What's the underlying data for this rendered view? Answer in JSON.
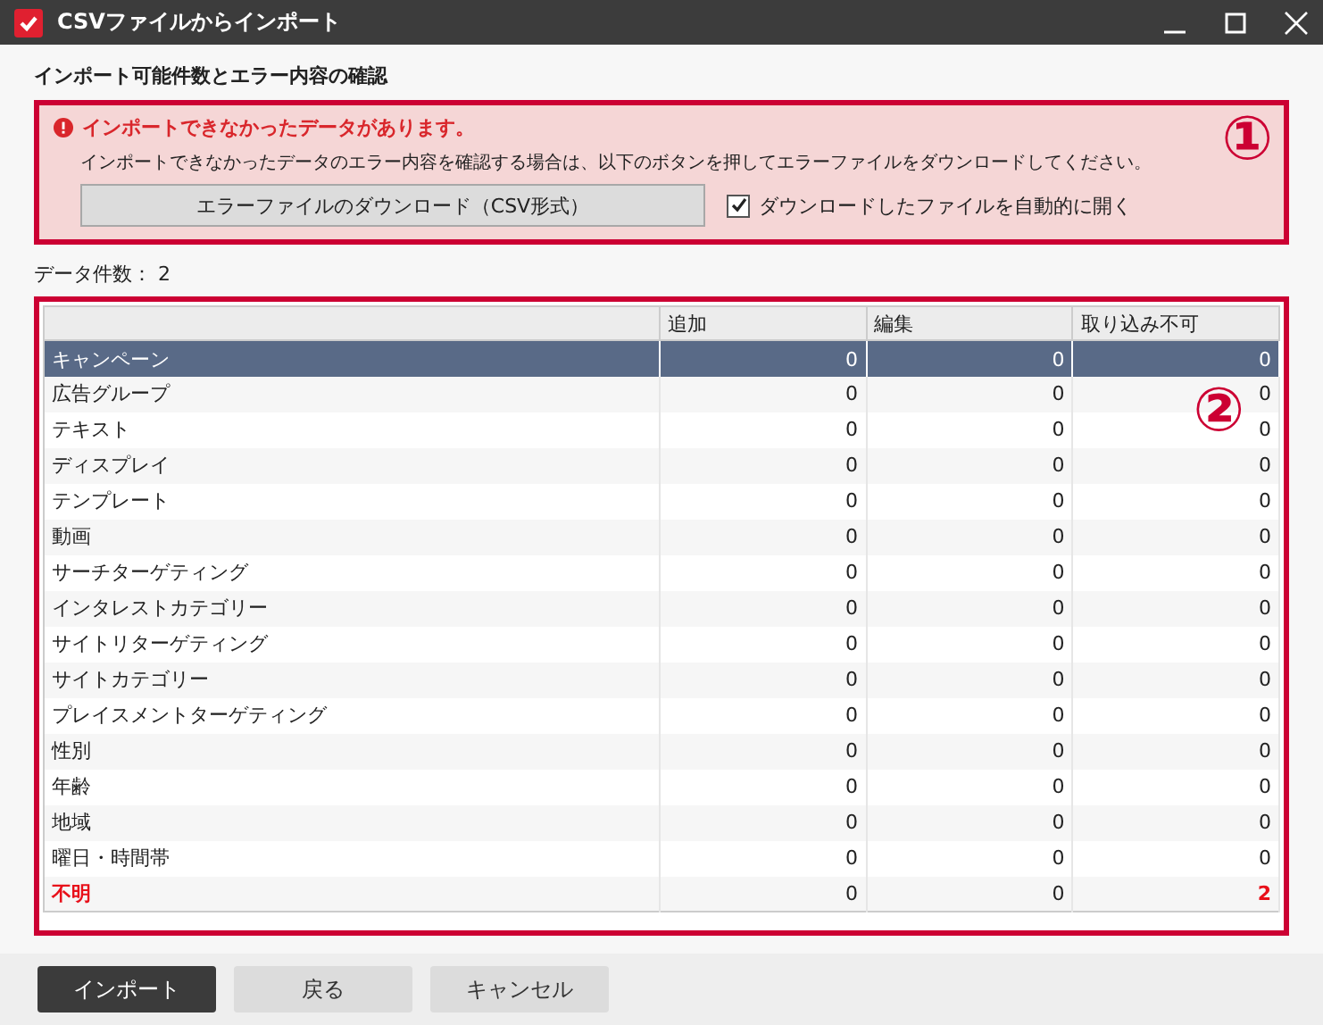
{
  "window": {
    "title": "CSVファイルからインポート"
  },
  "section_title": "インポート可能件数とエラー内容の確認",
  "error_box": {
    "heading": "インポートできなかったデータがあります。",
    "message": "インポートできなかったデータのエラー内容を確認する場合は、以下のボタンを押してエラーファイルをダウンロードしてください。",
    "download_button": "エラーファイルのダウンロード（CSV形式）",
    "auto_open": {
      "label": "ダウンロードしたファイルを自動的に開く",
      "checked": true
    },
    "callout": "①"
  },
  "data_count": {
    "label": "データ件数：",
    "value": "2"
  },
  "table": {
    "callout": "②",
    "columns": [
      "",
      "追加",
      "編集",
      "取り込み不可"
    ],
    "rows": [
      {
        "name": "キャンペーン",
        "values": [
          "0",
          "0",
          "0"
        ],
        "selected": true,
        "error": false
      },
      {
        "name": "広告グループ",
        "values": [
          "0",
          "0",
          "0"
        ],
        "selected": false,
        "error": false
      },
      {
        "name": "テキスト",
        "values": [
          "0",
          "0",
          "0"
        ],
        "selected": false,
        "error": false
      },
      {
        "name": "ディスプレイ",
        "values": [
          "0",
          "0",
          "0"
        ],
        "selected": false,
        "error": false
      },
      {
        "name": "テンプレート",
        "values": [
          "0",
          "0",
          "0"
        ],
        "selected": false,
        "error": false
      },
      {
        "name": "動画",
        "values": [
          "0",
          "0",
          "0"
        ],
        "selected": false,
        "error": false
      },
      {
        "name": "サーチターゲティング",
        "values": [
          "0",
          "0",
          "0"
        ],
        "selected": false,
        "error": false
      },
      {
        "name": "インタレストカテゴリー",
        "values": [
          "0",
          "0",
          "0"
        ],
        "selected": false,
        "error": false
      },
      {
        "name": "サイトリターゲティング",
        "values": [
          "0",
          "0",
          "0"
        ],
        "selected": false,
        "error": false
      },
      {
        "name": "サイトカテゴリー",
        "values": [
          "0",
          "0",
          "0"
        ],
        "selected": false,
        "error": false
      },
      {
        "name": "プレイスメントターゲティング",
        "values": [
          "0",
          "0",
          "0"
        ],
        "selected": false,
        "error": false
      },
      {
        "name": "性別",
        "values": [
          "0",
          "0",
          "0"
        ],
        "selected": false,
        "error": false
      },
      {
        "name": "年齢",
        "values": [
          "0",
          "0",
          "0"
        ],
        "selected": false,
        "error": false
      },
      {
        "name": "地域",
        "values": [
          "0",
          "0",
          "0"
        ],
        "selected": false,
        "error": false
      },
      {
        "name": "曜日・時間帯",
        "values": [
          "0",
          "0",
          "0"
        ],
        "selected": false,
        "error": false
      },
      {
        "name": "不明",
        "values": [
          "0",
          "0",
          "2"
        ],
        "selected": false,
        "error": true
      }
    ]
  },
  "buttons": [
    {
      "label": "インポート",
      "kind": "primary"
    },
    {
      "label": "戻る",
      "kind": "secondary"
    },
    {
      "label": "キャンセル",
      "kind": "secondary"
    }
  ]
}
